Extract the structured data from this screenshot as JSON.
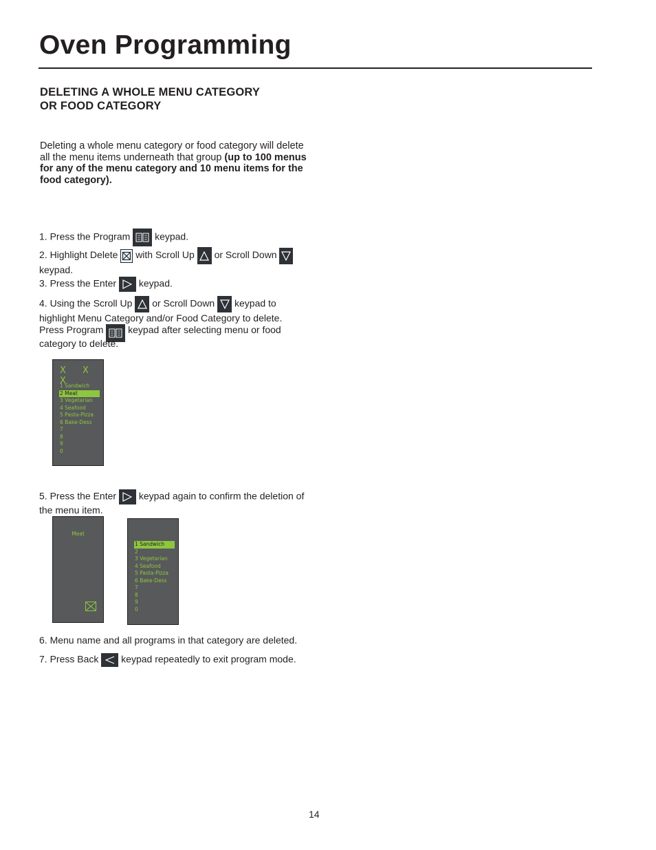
{
  "page": {
    "title": "Oven Programming",
    "section_heading_line1": "DELETING A WHOLE MENU CATEGORY",
    "section_heading_line2": "OR FOOD CATEGORY",
    "intro_plain": "Deleting a whole menu category or food category will delete all the menu items underneath that group ",
    "intro_bold": "(up to 100 menus for any of the menu category and 10 menu items for the food category).",
    "page_number": "14"
  },
  "steps": {
    "s1_a": "1. Press the Program",
    "s1_b": "keypad.",
    "s2_a": "2. Highlight Delete",
    "s2_b": "with Scroll Up",
    "s2_c": "or Scroll Down",
    "s2_d": "keypad.",
    "s3_a": "3. Press the Enter",
    "s3_b": "keypad.",
    "s4_a": "4. Using the Scroll Up",
    "s4_b": "or Scroll Down",
    "s4_c": "keypad to",
    "s4_d": "highlight Menu Category and/or Food Category to delete.",
    "s4_e": "Press Program",
    "s4_f": "keypad after selecting menu or food",
    "s4_g": "category to delete.",
    "s5_a": "5. Press the Enter",
    "s5_b": "keypad again to confirm the deletion of",
    "s5_c": "the menu item.",
    "s6": "6. Menu name and all programs in that category are deleted.",
    "s7_a": "7. Press Back",
    "s7_b": "keypad repeatedly to exit program mode."
  },
  "icons": {
    "program": "program-book-icon",
    "delete": "delete-x-box-icon",
    "scroll_up": "triangle-up-icon",
    "scroll_down": "triangle-down-icon",
    "enter": "triangle-right-icon",
    "back": "triangle-left-icon"
  },
  "colors": {
    "screen_bg": "#58595b",
    "screen_text": "#8dc63f",
    "keypad_bg": "#2e3236"
  },
  "screen1": {
    "header": "X X X",
    "items": [
      "1 Sandwich",
      "2 Meat",
      "3 Vegetarian",
      "4 Seafood",
      "5 Pasta-Pizza",
      "6 Bake-Dess",
      "7",
      "8",
      "9",
      "0"
    ],
    "selected": "2 Meat"
  },
  "screen2": {
    "label": "Meat"
  },
  "screen3": {
    "items": [
      "1 Sandwich",
      "2",
      "3 Vegetarian",
      "4 Seafood",
      "5 Pasta-Pizza",
      "6 Bake-Dess",
      "7",
      "8",
      "9",
      "0"
    ],
    "selected": "1 Sandwich"
  }
}
